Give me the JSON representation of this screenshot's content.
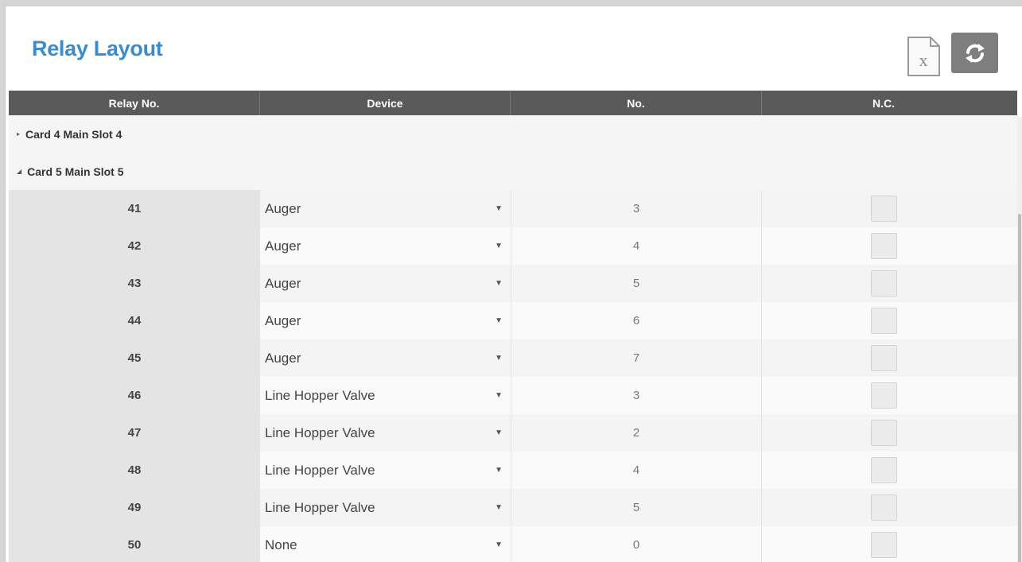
{
  "page": {
    "title": "Relay Layout"
  },
  "toolbar": {
    "excel_icon": "excel-export-icon",
    "excel_letter": "x",
    "refresh_icon": "refresh-icon"
  },
  "table": {
    "columns": [
      "Relay No.",
      "Device",
      "No.",
      "N.C."
    ],
    "groups": [
      {
        "label": "Card 4 Main Slot 4",
        "expanded": false
      },
      {
        "label": "Card 5 Main Slot 5",
        "expanded": true
      }
    ],
    "rows": [
      {
        "relay": "41",
        "device": "Auger",
        "no": "3",
        "nc": false
      },
      {
        "relay": "42",
        "device": "Auger",
        "no": "4",
        "nc": false
      },
      {
        "relay": "43",
        "device": "Auger",
        "no": "5",
        "nc": false
      },
      {
        "relay": "44",
        "device": "Auger",
        "no": "6",
        "nc": false
      },
      {
        "relay": "45",
        "device": "Auger",
        "no": "7",
        "nc": false
      },
      {
        "relay": "46",
        "device": "Line Hopper Valve",
        "no": "3",
        "nc": false
      },
      {
        "relay": "47",
        "device": "Line Hopper Valve",
        "no": "2",
        "nc": false
      },
      {
        "relay": "48",
        "device": "Line Hopper Valve",
        "no": "4",
        "nc": false
      },
      {
        "relay": "49",
        "device": "Line Hopper Valve",
        "no": "5",
        "nc": false
      },
      {
        "relay": "50",
        "device": "None",
        "no": "0",
        "nc": false
      }
    ]
  },
  "colors": {
    "title": "#3a8bd0",
    "header_bg": "#5a5a5a",
    "refresh_bg": "#7e7e7e"
  }
}
